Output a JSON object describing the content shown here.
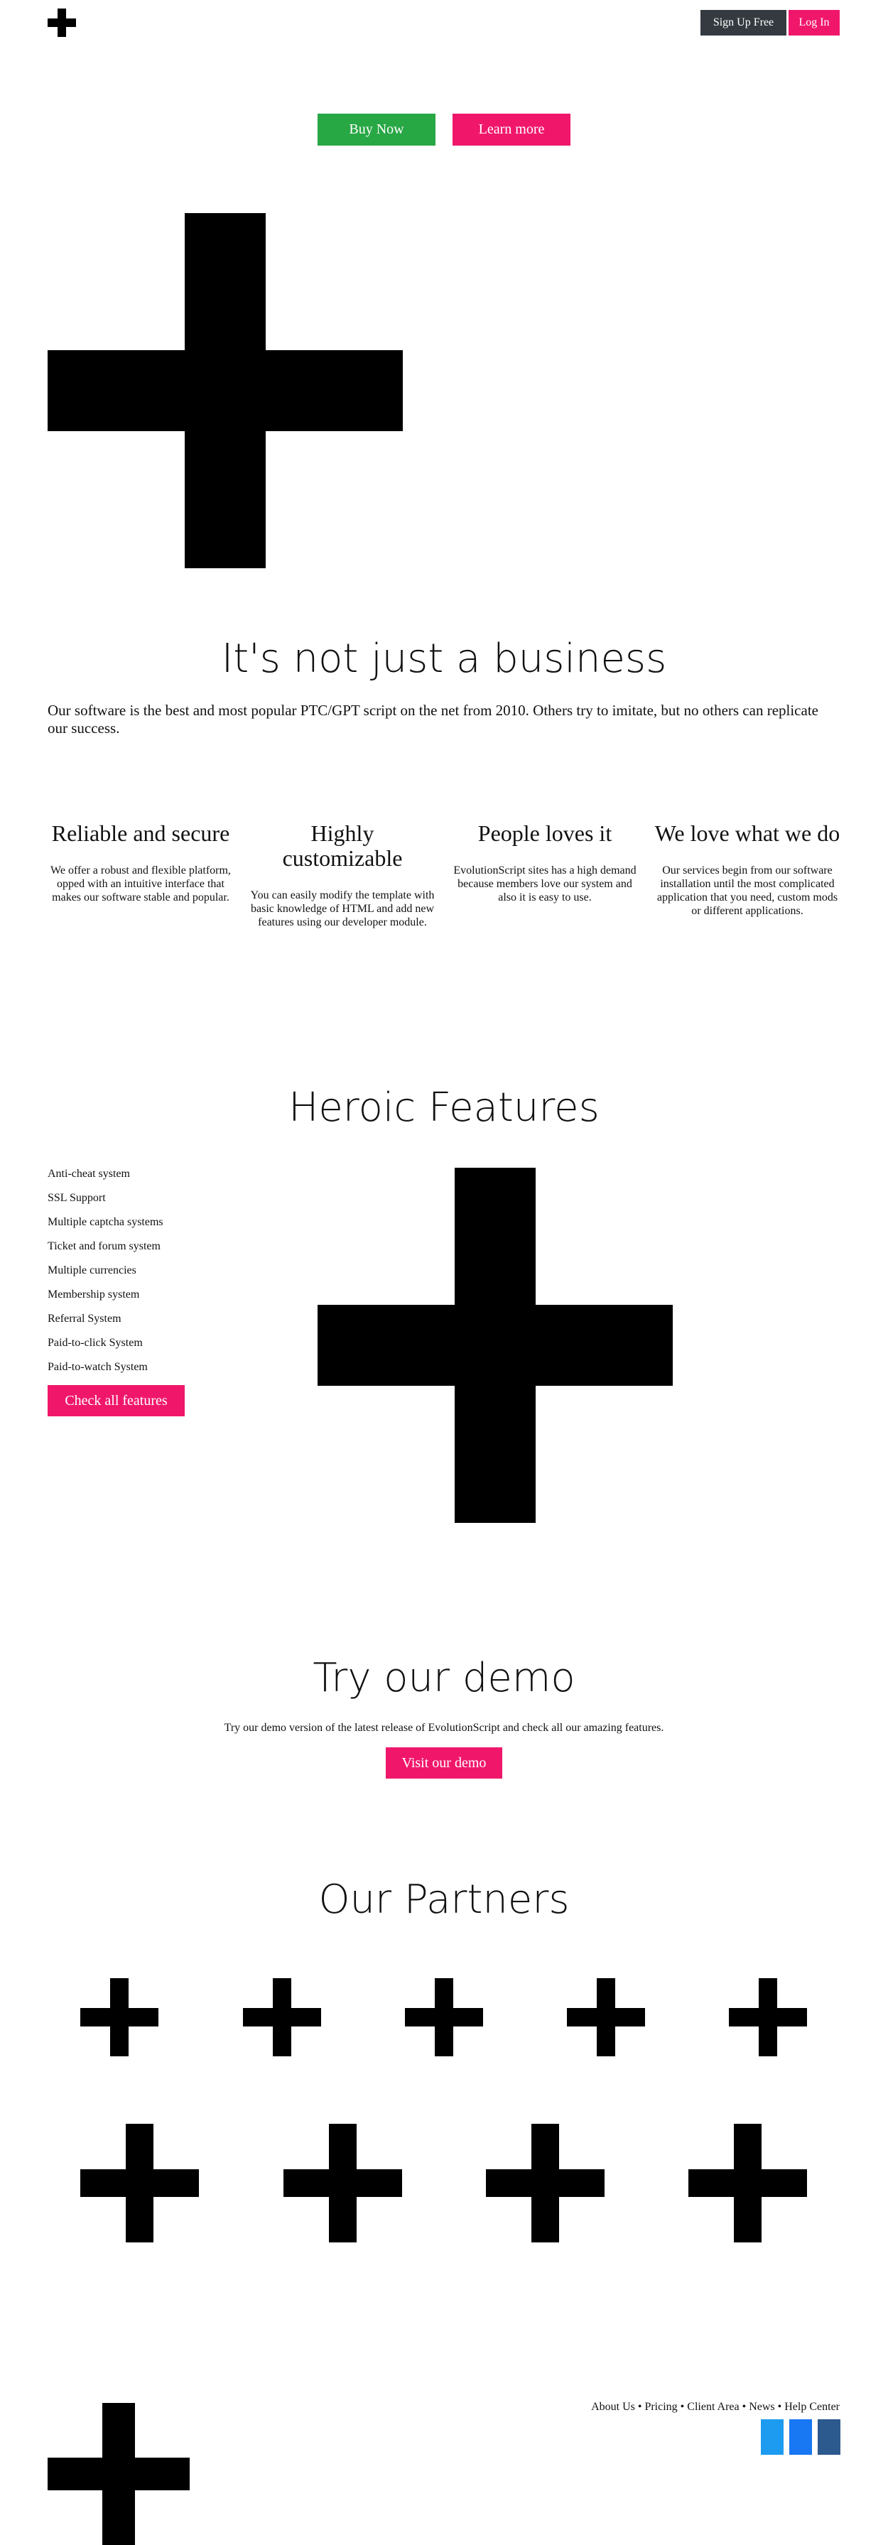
{
  "header": {
    "logo_icon": "plus-icon",
    "signup_label": "Sign Up Free",
    "login_label": "Log In"
  },
  "hero": {
    "buy_label": "Buy Now",
    "learn_label": "Learn more",
    "image_icon": "plus-icon"
  },
  "business": {
    "title": "It's not just a business",
    "text": "Our software is the best and most popular PTC/GPT script on the net from 2010. Others try to imitate, but no others can replicate our success."
  },
  "features_grid": [
    {
      "title": "Reliable and secure",
      "text": "We offer a robust and flexible platform, opped with an intuitive interface that makes our software stable and popular."
    },
    {
      "title": "Highly customizable",
      "text": "You can easily modify the template with basic knowledge of HTML and add new features using our developer module."
    },
    {
      "title": "People loves it",
      "text": "EvolutionScript sites has a high demand because members love our system and also it is easy to use."
    },
    {
      "title": "We love what we do",
      "text": "Our services begin from our software installation until the most complicated application that you need, custom mods or different applications."
    }
  ],
  "heroic": {
    "title": "Heroic Features",
    "items": [
      "Anti-cheat system",
      "SSL Support",
      "Multiple captcha systems",
      "Ticket and forum system",
      "Multiple currencies",
      "Membership system",
      "Referral System",
      "Paid-to-click System",
      "Paid-to-watch System"
    ],
    "button_label": "Check all features"
  },
  "demo": {
    "title": "Try our demo",
    "text": "Try our demo version of the latest release of EvolutionScript and check all our amazing features.",
    "button_label": "Visit our demo"
  },
  "partners": {
    "title": "Our Partners",
    "logo_icon": "plus-icon"
  },
  "footer": {
    "links": [
      "About Us",
      "Pricing",
      "Client Area",
      "News",
      "Help Center"
    ],
    "separator": " • ",
    "social": [
      {
        "name": "twitter-icon",
        "color": "#1d9bf0"
      },
      {
        "name": "facebook-icon",
        "color": "#1877f2"
      },
      {
        "name": "linkedin-icon",
        "color": "#2d5a8e"
      }
    ]
  },
  "colors": {
    "accent_pink": "#f0176b",
    "buy_green": "#28a745",
    "signup_dark": "#343a40",
    "logo_black": "#000000"
  }
}
